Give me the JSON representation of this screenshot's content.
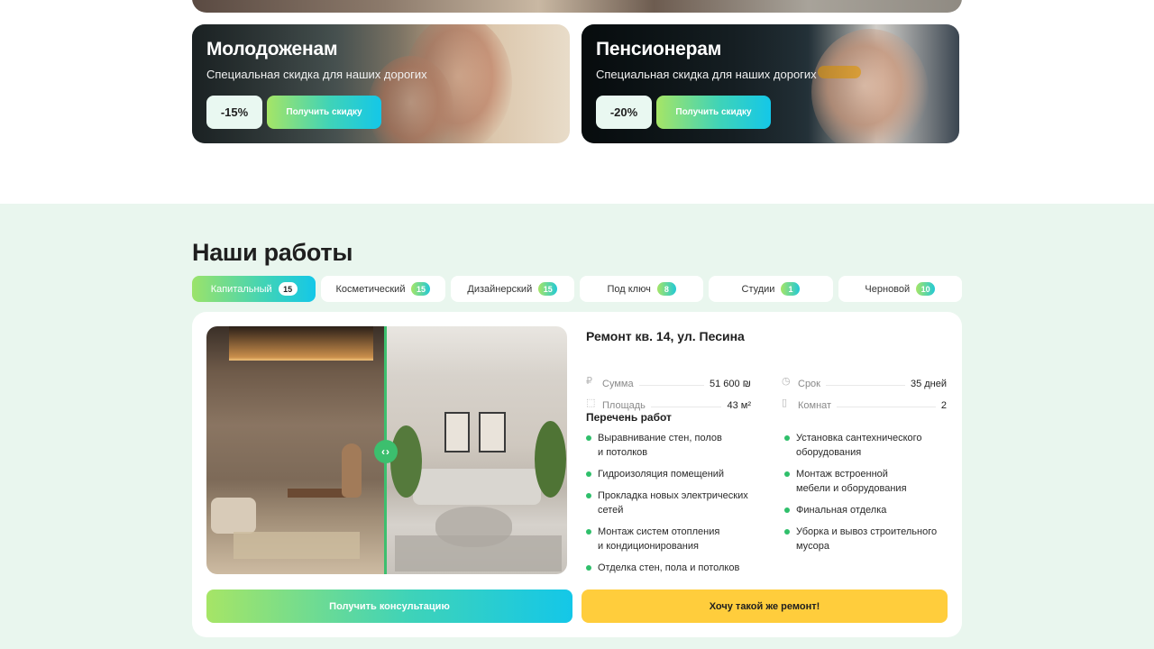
{
  "promos": [
    {
      "title": "Молодоженам",
      "subtitle": "Специальная скидка для наших дорогих",
      "discount": "-15%",
      "button": "Получить скидку"
    },
    {
      "title": "Пенсионерам",
      "subtitle": "Специальная скидка для наших дорогих",
      "discount": "-20%",
      "button": "Получить скидку"
    }
  ],
  "works": {
    "heading": "Наши работы",
    "tabs": [
      {
        "label": "Капитальный",
        "count": "15",
        "active": true
      },
      {
        "label": "Косметический",
        "count": "15"
      },
      {
        "label": "Дизайнерский",
        "count": "15"
      },
      {
        "label": "Под ключ",
        "count": "8"
      },
      {
        "label": "Студии",
        "count": "1"
      },
      {
        "label": "Черновой",
        "count": "10"
      }
    ],
    "project": {
      "title": "Ремонт кв. 14, ул. Песина",
      "specs": {
        "sum": {
          "icon": "ruble-icon",
          "label": "Сумма",
          "value": "51 600 ₪"
        },
        "area": {
          "icon": "area-icon",
          "label": "Площадь",
          "value": "43 м²"
        },
        "term": {
          "icon": "clock-icon",
          "label": "Срок",
          "value": "35 дней"
        },
        "rooms": {
          "icon": "door-icon",
          "label": "Комнат",
          "value": "2"
        }
      },
      "list_title": "Перечень работ",
      "works_left": [
        "Выравнивание стен, полов\nи потолков",
        "Гидроизоляция помещений",
        "Прокладка новых электрических\nсетей",
        "Монтаж систем отопления\nи кондиционирования",
        "Отделка стен, пола и потолков"
      ],
      "works_right": [
        "Установка сантехнического\nоборудования",
        "Монтаж встроенной\nмебели и оборудования",
        "Финальная отделка",
        "Уборка и вывоз строительного\nмусора"
      ],
      "slider_handle": "‹›",
      "buttons": {
        "consult": "Получить консультацию",
        "want": "Хочу такой же ремонт!"
      }
    }
  },
  "colors": {
    "accent_green": "#3cbf6e",
    "gradient_start": "#a6e566",
    "gradient_end": "#14c7e8",
    "yellow": "#ffcd3c",
    "section_bg": "#e9f6ee"
  }
}
